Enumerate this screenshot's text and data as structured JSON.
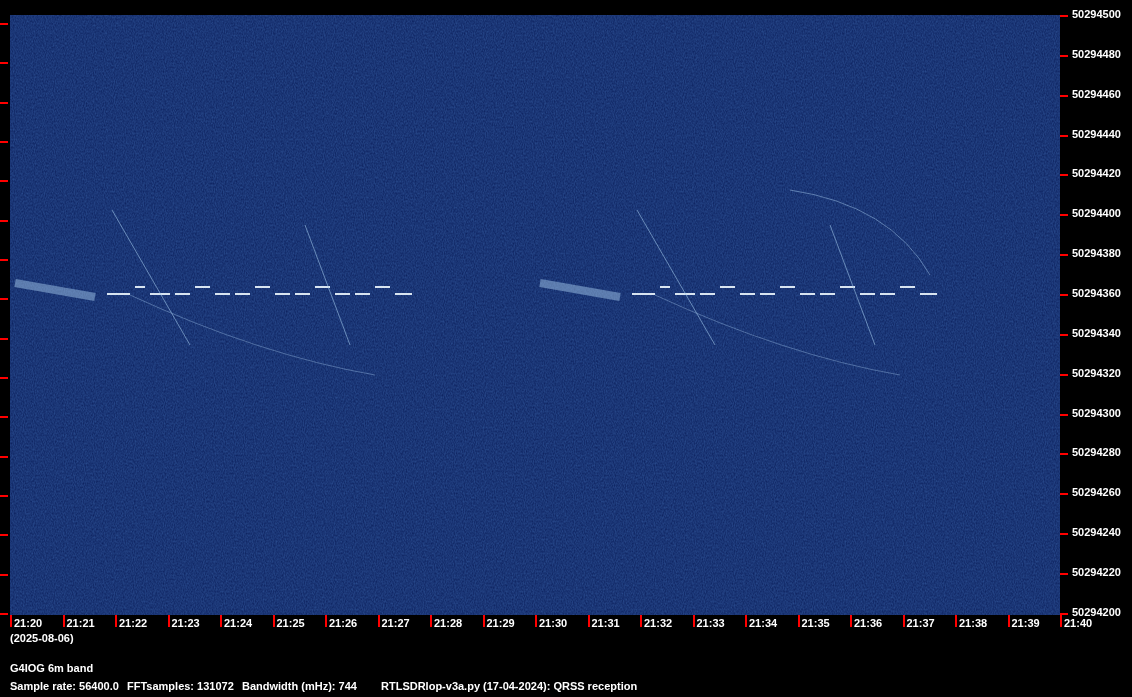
{
  "y_axis": {
    "labels": [
      "50294500",
      "50294480",
      "50294460",
      "50294440",
      "50294420",
      "50294400",
      "50294380",
      "50294360",
      "50294340",
      "50294320",
      "50294300",
      "50294280",
      "50294260",
      "50294240",
      "50294220",
      "50294200"
    ]
  },
  "x_axis": {
    "labels": [
      "21:20",
      "21:21",
      "21:22",
      "21:23",
      "21:24",
      "21:25",
      "21:26",
      "21:27",
      "21:28",
      "21:29",
      "21:30",
      "21:31",
      "21:32",
      "21:33",
      "21:34",
      "21:35",
      "21:36",
      "21:37",
      "21:38",
      "21:39",
      "21:40"
    ],
    "date": "(2025-08-06)"
  },
  "footer": {
    "title": "G4IOG 6m band",
    "info": [
      "Sample rate: 56400.0",
      "FFTsamples: 131072",
      "Bandwidth (mHz): 744",
      "RTLSDRlop-v3a.py (17-04-2024): QRSS reception"
    ]
  }
}
